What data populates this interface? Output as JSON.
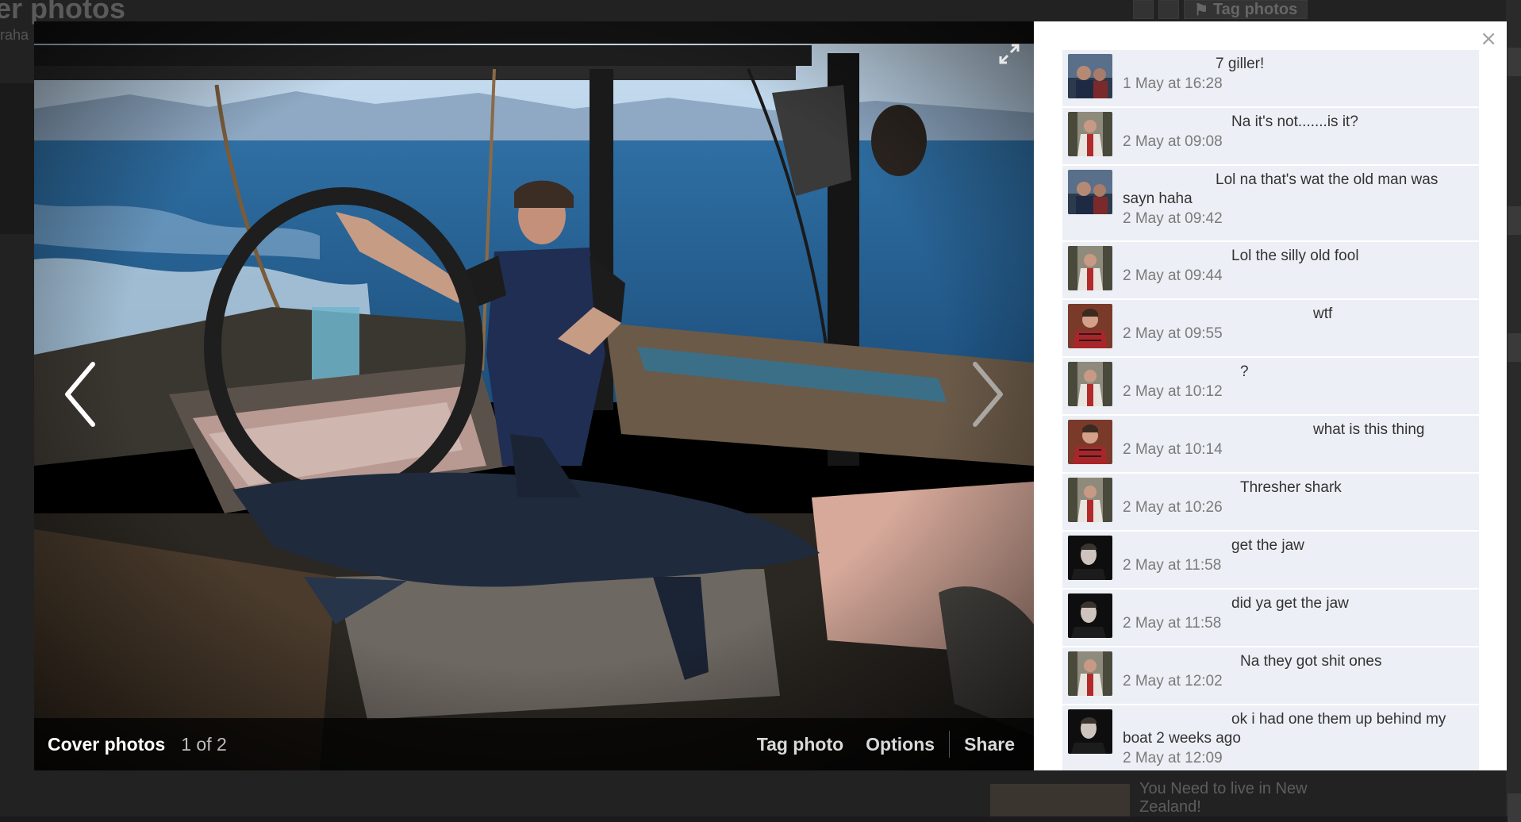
{
  "background": {
    "title": "er photos",
    "subtitle": "raha",
    "tag_button": "Tag photos",
    "news_text": "You Need to live in New Zealand!"
  },
  "photo_bar": {
    "album": "Cover photos",
    "count": "1 of 2",
    "tag_photo": "Tag photo",
    "options": "Options",
    "share": "Share"
  },
  "panel": {
    "close": "×"
  },
  "comments": [
    {
      "indent": 117,
      "text": "7 giller!",
      "time": "1 May at 16:28",
      "avatar": "boat"
    },
    {
      "indent": 137,
      "text": "Na it's not.......is it?",
      "time": "2 May at 09:08",
      "avatar": "red"
    },
    {
      "indent": 117,
      "text": "Lol na that's wat the old man was sayn haha",
      "time": "2 May at 09:42",
      "avatar": "boat"
    },
    {
      "indent": 137,
      "text": "Lol the silly old fool",
      "time": "2 May at 09:44",
      "avatar": "red"
    },
    {
      "indent": 240,
      "text": "wtf",
      "time": "2 May at 09:55",
      "avatar": "man"
    },
    {
      "indent": 148,
      "text": "?",
      "time": "2 May at 10:12",
      "avatar": "red"
    },
    {
      "indent": 240,
      "text": "what is this thing",
      "time": "2 May at 10:14",
      "avatar": "man"
    },
    {
      "indent": 148,
      "text": "Thresher shark",
      "time": "2 May at 10:26",
      "avatar": "red"
    },
    {
      "indent": 137,
      "text": "get the jaw",
      "time": "2 May at 11:58",
      "avatar": "dark"
    },
    {
      "indent": 137,
      "text": "did ya get the jaw",
      "time": "2 May at 11:58",
      "avatar": "dark"
    },
    {
      "indent": 148,
      "text": "Na they got shit ones",
      "time": "2 May at 12:02",
      "avatar": "red"
    },
    {
      "indent": 137,
      "text": "ok i had one them up behind my boat 2 weeks ago",
      "time": "2 May at 12:09",
      "avatar": "dark"
    }
  ]
}
